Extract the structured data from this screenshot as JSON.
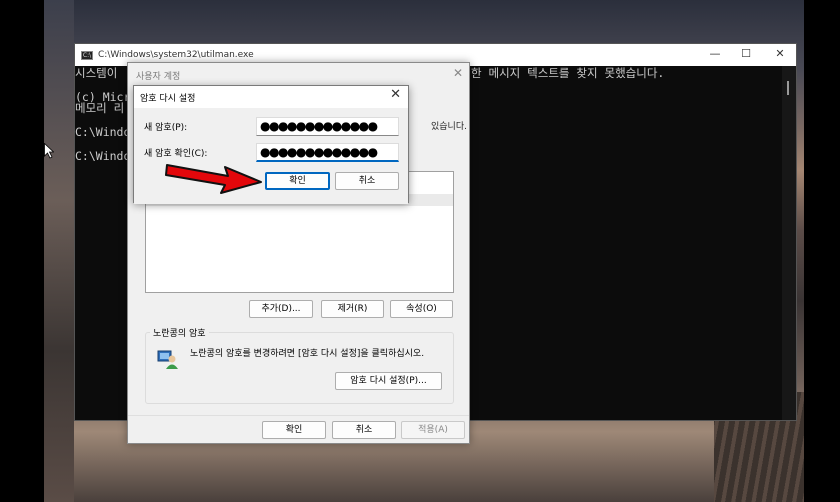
{
  "cmd": {
    "title": "C:\\Windows\\system32\\utilman.exe",
    "icon_text": "C:\\",
    "controls": {
      "minimize": "—",
      "maximize": "☐",
      "close": "✕"
    },
    "lines": [
      "시스템이",
      "한 메시지 텍스트를 찾지 못했습니다.",
      "(c) Micro",
      "메모리 리",
      "C:\\Windo",
      "C:\\Windo",
      "있습니다."
    ]
  },
  "user_accounts": {
    "title": "사용자 계정",
    "close": "✕",
    "add_button": "추가(D)...",
    "remove_button": "제거(R)",
    "properties_button": "속성(O)",
    "group_label": "노란콩의 암호",
    "group_text": "노란콩의 암호를 변경하려면 [암호 다시 설정]을 클릭하십시오.",
    "reset_button": "암호 다시 설정(P)...",
    "ok_button": "확인",
    "cancel_button": "취소",
    "apply_button": "적용(A)"
  },
  "reset_password": {
    "title": "암호 다시 설정",
    "close": "✕",
    "new_password_label": "새 암호(P):",
    "new_password_value": "●●●●●●●●●●●●●",
    "confirm_password_label": "새 암호 확인(C):",
    "confirm_password_value": "●●●●●●●●●●●●●",
    "ok_button": "확인",
    "cancel_button": "취소"
  },
  "colors": {
    "arrow": "#e3070b",
    "accent": "#0067c0"
  }
}
